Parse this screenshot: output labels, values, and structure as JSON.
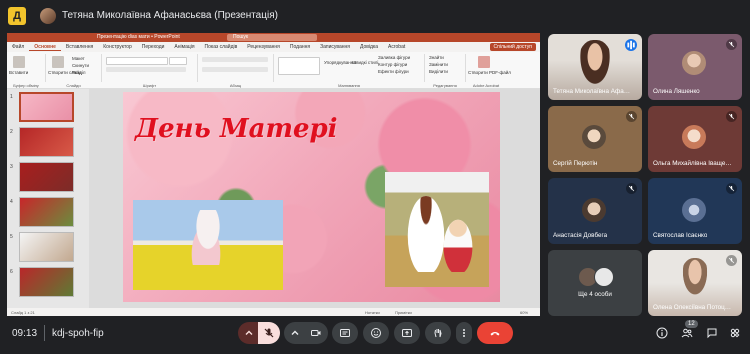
{
  "header": {
    "presenter_title": "Тетяна Миколаївна Афанасьєва (Презентація)"
  },
  "powerpoint": {
    "window_title": "Презентацію dias мати • PowerPoint",
    "search_placeholder": "Пошук",
    "share_label": "Спільний доступ",
    "tabs": [
      "Файл",
      "Основне",
      "Вставлення",
      "Конструктор",
      "Переходи",
      "Анімація",
      "Показ слайдів",
      "Рецензування",
      "Подання",
      "Записування",
      "Довідка",
      "Acrobat"
    ],
    "active_tab": "Основне",
    "ribbon_groups": [
      "Буфер обміну",
      "Слайди",
      "Шрифт",
      "Абзац",
      "Малювання",
      "Редагування",
      "Adobe Acrobat"
    ],
    "ribbon_items": {
      "paste": "Вставити",
      "new_slide": "Створити слайд",
      "layout": "Макет",
      "reset": "Скинути",
      "section": "Розділ",
      "arrange": "Упорядкування",
      "quick_styles": "Швидкі стилі",
      "shape_fill": "Заливка фігури",
      "shape_outline": "Контур фігури",
      "shape_effects": "Ефекти фігури",
      "find": "Знайти",
      "replace": "Замінити",
      "select": "Виділити",
      "create_pdf": "Створити PDF-файл"
    },
    "thumbnails": [
      {
        "num": "1"
      },
      {
        "num": "2"
      },
      {
        "num": "3"
      },
      {
        "num": "4"
      },
      {
        "num": "5"
      },
      {
        "num": "6"
      }
    ],
    "slide": {
      "title": "День Матері"
    },
    "status": {
      "slide_info": "Слайд 1 з 21",
      "notes": "Нотатки",
      "comments": "Примітки",
      "zoom": "60%"
    }
  },
  "participants": [
    {
      "name": "Тетяна Миколаївна Афана...",
      "speaking": true
    },
    {
      "name": "Олина Ляшенко",
      "muted": true
    },
    {
      "name": "Сергій Перютін",
      "muted": true
    },
    {
      "name": "Ольга Михайлівна Іващен...",
      "muted": true
    },
    {
      "name": "Анастасія Довбега",
      "muted": true
    },
    {
      "name": "Святослав Ісаєнко",
      "muted": true
    },
    {
      "name": "Ще 4 особи"
    },
    {
      "name": "Олена Олексіївна Потоцьк...",
      "muted": true
    }
  ],
  "bottombar": {
    "time": "09:13",
    "meeting_code": "kdj-spoh-fip",
    "people_count": "12"
  },
  "colors": {
    "background": "#202124",
    "tile": "#3c4043",
    "leave_red": "#ea4335",
    "mic_muted_bg": "#f9dedc",
    "powerpoint_accent": "#b7472a"
  }
}
